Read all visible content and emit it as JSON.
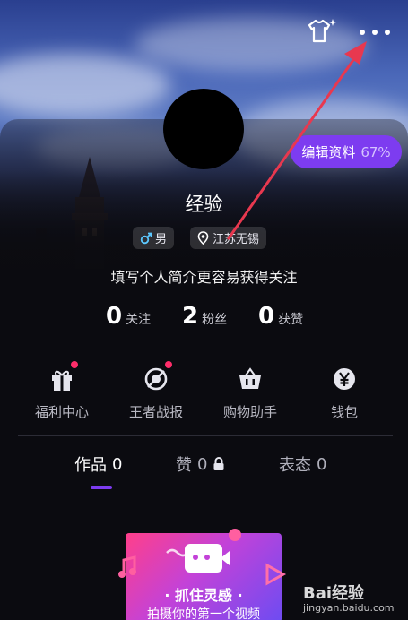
{
  "profile": {
    "name": "经验",
    "gender": "男",
    "location": "江苏无锡",
    "bio_prompt": "填写个人简介更容易获得关注",
    "edit_label": "编辑资料",
    "edit_progress": "67%"
  },
  "stats": [
    {
      "value": "0",
      "label": "关注"
    },
    {
      "value": "2",
      "label": "粉丝"
    },
    {
      "value": "0",
      "label": "获赞"
    }
  ],
  "features": [
    {
      "label": "福利中心",
      "icon": "gift-icon",
      "badge": true
    },
    {
      "label": "王者战报",
      "icon": "game-report-icon",
      "badge": true
    },
    {
      "label": "购物助手",
      "icon": "shopping-basket-icon",
      "badge": false
    },
    {
      "label": "钱包",
      "icon": "wallet-yen-icon",
      "badge": false
    }
  ],
  "tabs": [
    {
      "label": "作品",
      "count": "0",
      "active": true
    },
    {
      "label": "赞",
      "count": "0",
      "locked": true
    },
    {
      "label": "表态",
      "count": "0"
    }
  ],
  "promo": {
    "title": "· 抓住灵感 ·",
    "subtitle": "拍摄你的第一个视频"
  },
  "watermark": {
    "brand": "Bai经验",
    "url": "jingyan.baidu.com"
  },
  "colors": {
    "accent": "#7d3cf0",
    "badge": "#ff2d6a",
    "annotation_arrow": "#e8384f"
  }
}
